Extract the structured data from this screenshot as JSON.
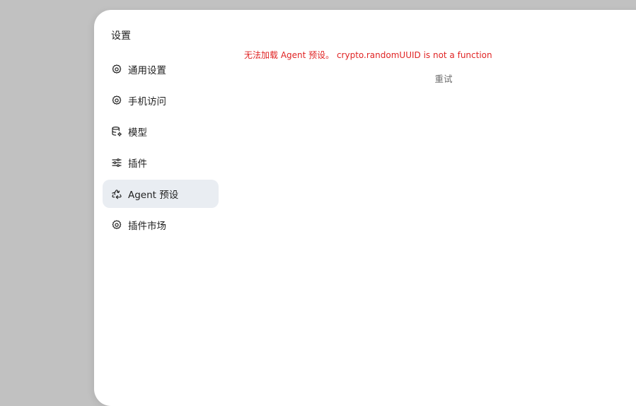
{
  "settings": {
    "title": "设置"
  },
  "sidebar": {
    "items": [
      {
        "label": "通用设置",
        "icon": "gear-icon",
        "active": false
      },
      {
        "label": "手机访问",
        "icon": "gear-icon",
        "active": false
      },
      {
        "label": "模型",
        "icon": "database-gear-icon",
        "active": false
      },
      {
        "label": "插件",
        "icon": "sliders-icon",
        "active": false
      },
      {
        "label": "Agent 预设",
        "icon": "recycle-triangle-icon",
        "active": true
      },
      {
        "label": "插件市场",
        "icon": "gear-icon",
        "active": false
      }
    ]
  },
  "main": {
    "error_message": "无法加载 Agent 预设。 crypto.randomUUID is not a function",
    "retry_label": "重试"
  },
  "colors": {
    "background": "#c1c1c1",
    "panel": "#ffffff",
    "active_item": "#e9edf2",
    "error": "#e02424",
    "muted_text": "#6b6b6b"
  }
}
